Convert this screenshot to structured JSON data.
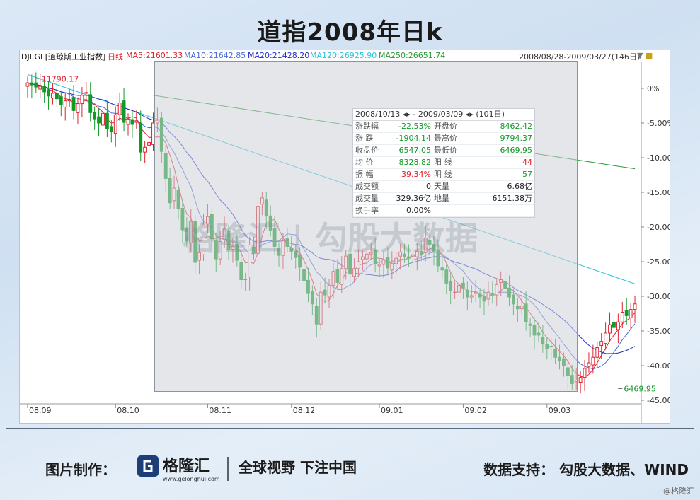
{
  "title": "道指2008年日k",
  "info": {
    "ticker": "DJI.GI [道琼斯工业指数]",
    "period": "日线",
    "ma5": "MA5:21601.33",
    "ma10": "MA10:21642.85",
    "ma20": "MA20:21428.20",
    "ma120": "MA120:26925.90",
    "ma250": "MA250:26651.74",
    "range": "2008/08/28-2009/03/27(146日)"
  },
  "colors": {
    "up": "#e0202c",
    "down": "#129a27",
    "ma5": "#e0202c",
    "ma10": "#4b6cd9",
    "ma20": "#1f2fc9",
    "ma120": "#2cc2d6",
    "ma250": "#2a9a3a"
  },
  "stats": {
    "header": "2008/10/13 ◂▸ - 2009/03/09 ◂▸ (101日)",
    "rows": [
      {
        "k1": "涨跌幅",
        "v1": "-22.53%",
        "k2": "开盘价",
        "v2": "8462.42",
        "c1": "#129a27",
        "c2": "#129a27"
      },
      {
        "k1": "涨  跌",
        "v1": "-1904.14",
        "k2": "最高价",
        "v2": "9794.37",
        "c1": "#129a27",
        "c2": "#129a27"
      },
      {
        "k1": "收盘价",
        "v1": "6547.05",
        "k2": "最低价",
        "v2": "6469.95",
        "c1": "#129a27",
        "c2": "#129a27"
      },
      {
        "k1": "均  价",
        "v1": "8328.82",
        "k2": "阳  线",
        "v2": "44",
        "c1": "#129a27",
        "c2": "#e0202c"
      },
      {
        "k1": "振  幅",
        "v1": "39.34%",
        "k2": "阴  线",
        "v2": "57",
        "c1": "#e0202c",
        "c2": "#129a27"
      },
      {
        "k1": "成交额",
        "v1": "0",
        "k2": "天量",
        "v2": "6.68亿",
        "c1": "#222222",
        "c2": "#222222"
      },
      {
        "k1": "成交量",
        "v1": "329.36亿",
        "k2": "地量",
        "v2": "6151.38万",
        "c1": "#222222",
        "c2": "#222222"
      },
      {
        "k1": "换手率",
        "v1": "0.00%",
        "k2": "",
        "v2": "",
        "c1": "#222222",
        "c2": "#222222"
      }
    ]
  },
  "watermark": "格隆汇 | 勾股大数据",
  "footer": {
    "left": "图片制作：",
    "logo_text": "格隆汇",
    "logo_url": "www.gelonghui.com",
    "slogan": "全球视野 下注中国",
    "right": "数据支持：  勾股大数据、WIND",
    "corner": "@格隆汇"
  },
  "chart_data": {
    "type": "candlestick",
    "title": "",
    "x_tick_labels": [
      "08.09",
      "08.10",
      "08.11",
      "08.12",
      "09.01",
      "09.02",
      "09.03"
    ],
    "y_tick_labels": [
      "0%",
      "-5.00%",
      "-10.00%",
      "-15.00%",
      "-20.00%",
      "-25.00%",
      "-30.00%",
      "-35.00%",
      "-40.00%",
      "-45.00%"
    ],
    "ylim_pct": [
      -45,
      0
    ],
    "annotations": [
      {
        "label": "11790.17",
        "day": 2,
        "pct": 1.4
      },
      {
        "label": "6469.95",
        "day": 141,
        "pct": -43.3
      }
    ],
    "ma_legend": [
      "MA5",
      "MA10",
      "MA20",
      "MA120",
      "MA250"
    ],
    "series_ma120_pct": {
      "days": [
        0,
        145
      ],
      "values": [
        2,
        -28.2
      ]
    },
    "series_ma250_pct": {
      "days": [
        30,
        145
      ],
      "values": [
        -1,
        -11.6
      ]
    },
    "candles_pct_close": [
      0.8,
      0.5,
      0.2,
      0.3,
      -0.5,
      -1.1,
      -0.7,
      -1.5,
      -2.4,
      -1.8,
      -1.6,
      -3.2,
      -2.2,
      -1.0,
      -0.6,
      -3.5,
      -4.4,
      -5.0,
      -3.6,
      -5.8,
      -6.2,
      -3.8,
      -2.1,
      -4.9,
      -4.5,
      -5.2,
      -4.7,
      -9.2,
      -8.5,
      -7.8,
      -5.0,
      -4.6,
      -9.1,
      -13.0,
      -16.5,
      -14.4,
      -17.3,
      -20.4,
      -22.0,
      -19.2,
      -25.1,
      -23.7,
      -19.6,
      -18.5,
      -21.7,
      -24.6,
      -22.1,
      -20.3,
      -23.2,
      -22.8,
      -24.8,
      -27.6,
      -27.5,
      -22.6,
      -23.8,
      -17.0,
      -15.8,
      -18.4,
      -20.5,
      -22.8,
      -24.1,
      -22.0,
      -22.8,
      -23.5,
      -24.4,
      -25.8,
      -27.7,
      -29.6,
      -31.1,
      -34.0,
      -29.4,
      -29.8,
      -28.4,
      -26.4,
      -28.0,
      -26.0,
      -24.2,
      -26.8,
      -26.0,
      -25.0,
      -24.3,
      -23.9,
      -23.7,
      -25.3,
      -25.4,
      -24.7,
      -25.9,
      -25.3,
      -24.5,
      -23.6,
      -24.3,
      -24.5,
      -24.0,
      -23.5,
      -24.0,
      -21.6,
      -22.5,
      -23.6,
      -25.6,
      -26.2,
      -28.1,
      -29.2,
      -29.4,
      -28.4,
      -28.8,
      -30.1,
      -29.9,
      -29.4,
      -30.1,
      -30.7,
      -29.4,
      -29.8,
      -28.3,
      -27.6,
      -28.8,
      -30.1,
      -31.1,
      -31.8,
      -31.4,
      -33.7,
      -34.2,
      -35.6,
      -35.6,
      -36.9,
      -37.5,
      -37.3,
      -38.8,
      -39.3,
      -40.0,
      -41.4,
      -42.6,
      -42.1,
      -41.7,
      -40.4,
      -39.6,
      -38.8,
      -37.4,
      -36.5,
      -35.3,
      -34.1,
      -34.5,
      -33.7,
      -32.3,
      -32.8,
      -31.9,
      -31.1
    ]
  }
}
